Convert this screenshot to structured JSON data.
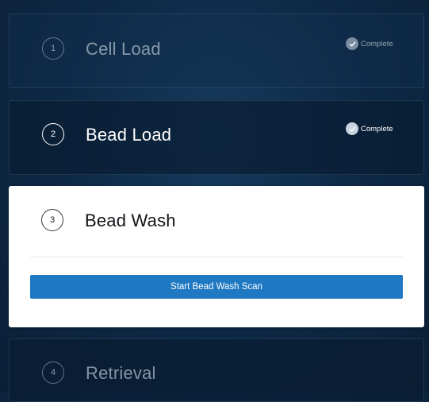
{
  "steps": [
    {
      "number": "1",
      "title": "Cell Load",
      "status": "Complete",
      "status_icon": "check-circle-icon"
    },
    {
      "number": "2",
      "title": "Bead Load",
      "status": "Complete",
      "status_icon": "check-circle-icon"
    },
    {
      "number": "3",
      "title": "Bead Wash",
      "action_label": "Start Bead Wash Scan"
    },
    {
      "number": "4",
      "title": "Retrieval"
    }
  ],
  "colors": {
    "background": "#0e2a47",
    "active_card": "#ffffff",
    "primary_button": "#1f78c2"
  }
}
